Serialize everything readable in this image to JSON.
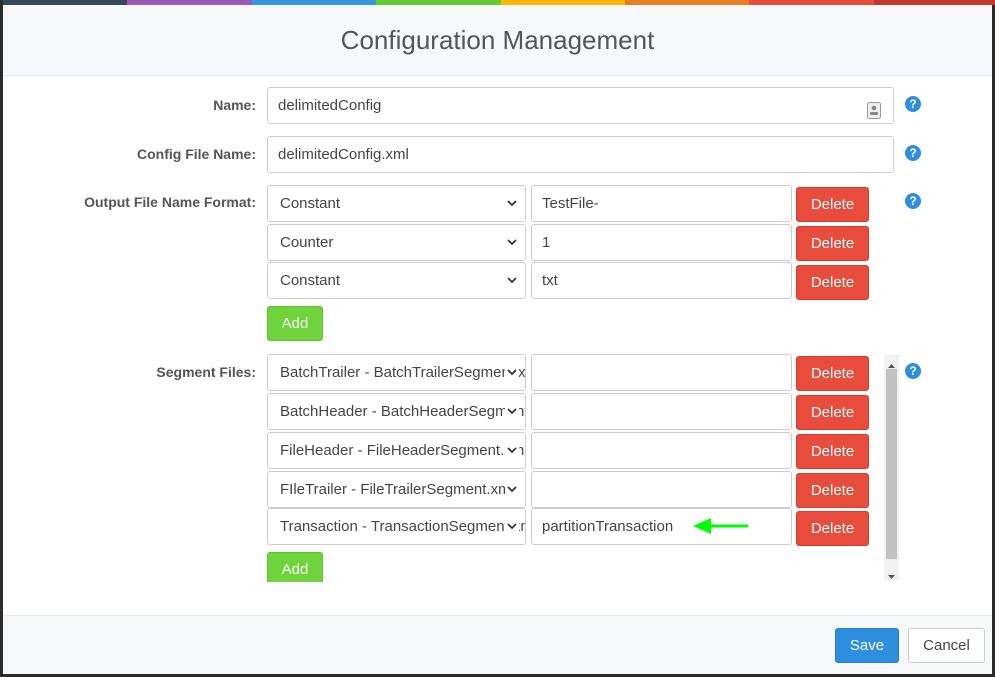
{
  "title": "Configuration Management",
  "colors": {
    "stripe": [
      "#34495e",
      "#9b59b6",
      "#3498db",
      "#62cb31",
      "#ffb606",
      "#e67e22",
      "#e74c3c",
      "#c0392b"
    ],
    "primary": "#2e8ee0",
    "danger": "#e74c3c",
    "success": "#6fd33c",
    "annotation_arrow": "#00ff00"
  },
  "name": {
    "label": "Name:",
    "value": "delimitedConfig",
    "icon": "contact-card-icon"
  },
  "config_file": {
    "label": "Config File Name:",
    "value": "delimitedConfig.xml"
  },
  "output_format": {
    "label": "Output File Name Format:",
    "rows": [
      {
        "type": "Constant",
        "value": "TestFile-",
        "delete_label": "Delete"
      },
      {
        "type": "Counter",
        "value": "1",
        "delete_label": "Delete"
      },
      {
        "type": "Constant",
        "value": "txt",
        "delete_label": "Delete"
      }
    ],
    "add_label": "Add"
  },
  "segment_files": {
    "label": "Segment Files:",
    "rows": [
      {
        "segment": "BatchTrailer - BatchTrailerSegment.xml",
        "value": "",
        "delete_label": "Delete"
      },
      {
        "segment": "BatchHeader - BatchHeaderSegment.xml",
        "value": "",
        "delete_label": "Delete"
      },
      {
        "segment": "FileHeader - FileHeaderSegment.xml",
        "value": "",
        "delete_label": "Delete"
      },
      {
        "segment": "FIleTrailer - FileTrailerSegment.xml",
        "value": "",
        "delete_label": "Delete"
      },
      {
        "segment": "Transaction - TransactionSegment.xml",
        "value": "partitionTransaction",
        "delete_label": "Delete"
      }
    ],
    "add_label": "Add"
  },
  "help_icon": "?",
  "footer": {
    "save_label": "Save",
    "cancel_label": "Cancel"
  }
}
